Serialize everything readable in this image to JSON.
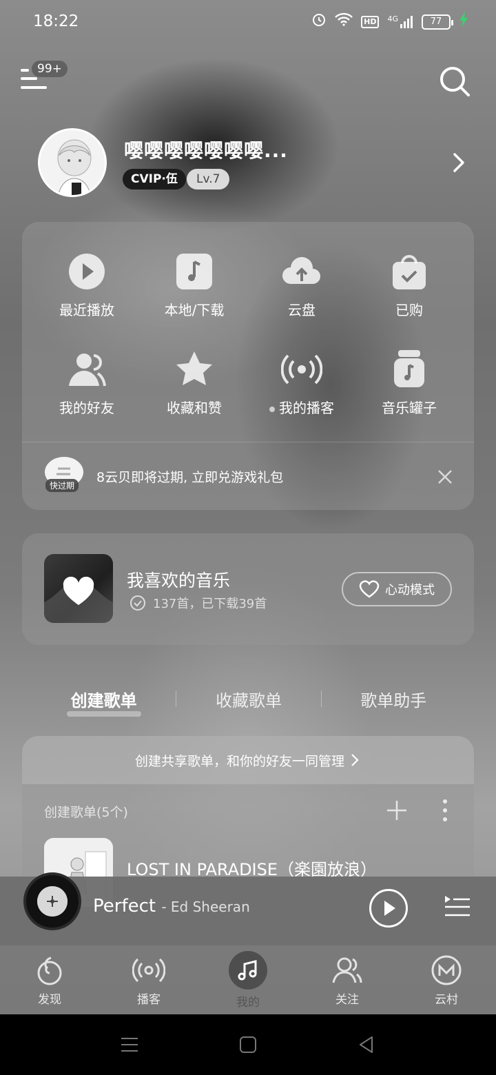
{
  "status_bar": {
    "time": "18:22",
    "network": "4G",
    "hd": "HD",
    "battery": "77"
  },
  "header": {
    "menu_badge": "99+"
  },
  "profile": {
    "username": "嘤嘤嘤嘤嘤嘤嘤...",
    "vip": "CVIP·伍",
    "level": "Lv.7"
  },
  "grid": [
    {
      "label": "最近播放",
      "icon": "play-circle-icon"
    },
    {
      "label": "本地/下载",
      "icon": "music-file-icon"
    },
    {
      "label": "云盘",
      "icon": "cloud-upload-icon"
    },
    {
      "label": "已购",
      "icon": "shopping-bag-icon"
    },
    {
      "label": "我的好友",
      "icon": "friends-icon"
    },
    {
      "label": "收藏和赞",
      "icon": "star-icon"
    },
    {
      "label": "我的播客",
      "icon": "broadcast-icon"
    },
    {
      "label": "音乐罐子",
      "icon": "music-jar-icon"
    }
  ],
  "notice": {
    "tag": "快过期",
    "text": "8云贝即将过期, 立即兑游戏礼包"
  },
  "liked": {
    "title": "我喜欢的音乐",
    "sub": "137首，已下载39首",
    "heart_mode": "心动模式"
  },
  "tabs": [
    "创建歌单",
    "收藏歌单",
    "歌单助手"
  ],
  "playlists": {
    "shared_banner": "创建共享歌单，和你的好友一同管理",
    "created_label": "创建歌单(5个)",
    "first_title": "LOST IN PARADISE（楽園放浪）"
  },
  "player": {
    "title": "Perfect",
    "artist": "- Ed Sheeran"
  },
  "nav": [
    {
      "label": "发现",
      "icon": "discover-icon"
    },
    {
      "label": "播客",
      "icon": "podcast-icon"
    },
    {
      "label": "我的",
      "icon": "music-note-icon"
    },
    {
      "label": "关注",
      "icon": "follow-icon"
    },
    {
      "label": "云村",
      "icon": "village-icon"
    }
  ]
}
